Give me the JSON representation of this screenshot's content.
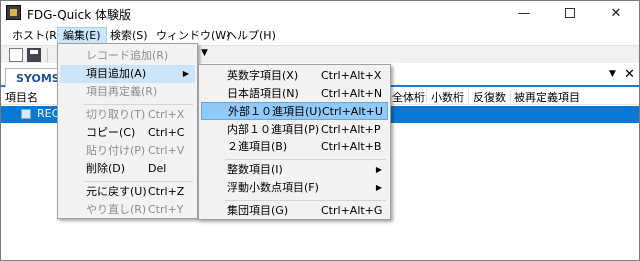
{
  "window": {
    "title": "FDG-Quick 体験版"
  },
  "menubar": {
    "items": [
      "ホスト(R)",
      "編集(E)",
      "検索(S)",
      "ウィンドウ(W)",
      "ヘルプ(H)"
    ]
  },
  "tabs": {
    "active_tab": "SYOMS"
  },
  "grid": {
    "headers": [
      "項目名",
      "全体桁",
      "小数桁",
      "反復数",
      "被再定義項目"
    ],
    "selected_row": "REC"
  },
  "edit_menu": {
    "items": [
      {
        "label": "レコード追加(R)",
        "accel": ""
      },
      {
        "label": "項目追加(A)",
        "accel": ""
      },
      {
        "label": "項目再定義(R)",
        "accel": ""
      },
      {
        "label": "切り取り(T)",
        "accel": "Ctrl+X"
      },
      {
        "label": "コピー(C)",
        "accel": "Ctrl+C"
      },
      {
        "label": "貼り付け(P)",
        "accel": "Ctrl+V"
      },
      {
        "label": "削除(D)",
        "accel": "Del"
      },
      {
        "label": "元に戻す(U)",
        "accel": "Ctrl+Z"
      },
      {
        "label": "やり直し(R)",
        "accel": "Ctrl+Y"
      }
    ]
  },
  "add_item_menu": {
    "items": [
      {
        "label": "英数字項目(X)",
        "accel": "Ctrl+Alt+X"
      },
      {
        "label": "日本語項目(N)",
        "accel": "Ctrl+Alt+N"
      },
      {
        "label": "外部１０進項目(U)",
        "accel": "Ctrl+Alt+U"
      },
      {
        "label": "内部１０進項目(P)",
        "accel": "Ctrl+Alt+P"
      },
      {
        "label": "２進項目(B)",
        "accel": "Ctrl+Alt+B"
      },
      {
        "label": "整数項目(I)",
        "accel": ""
      },
      {
        "label": "浮動小数点項目(F)",
        "accel": ""
      },
      {
        "label": "集団項目(G)",
        "accel": "Ctrl+Alt+G"
      }
    ]
  }
}
